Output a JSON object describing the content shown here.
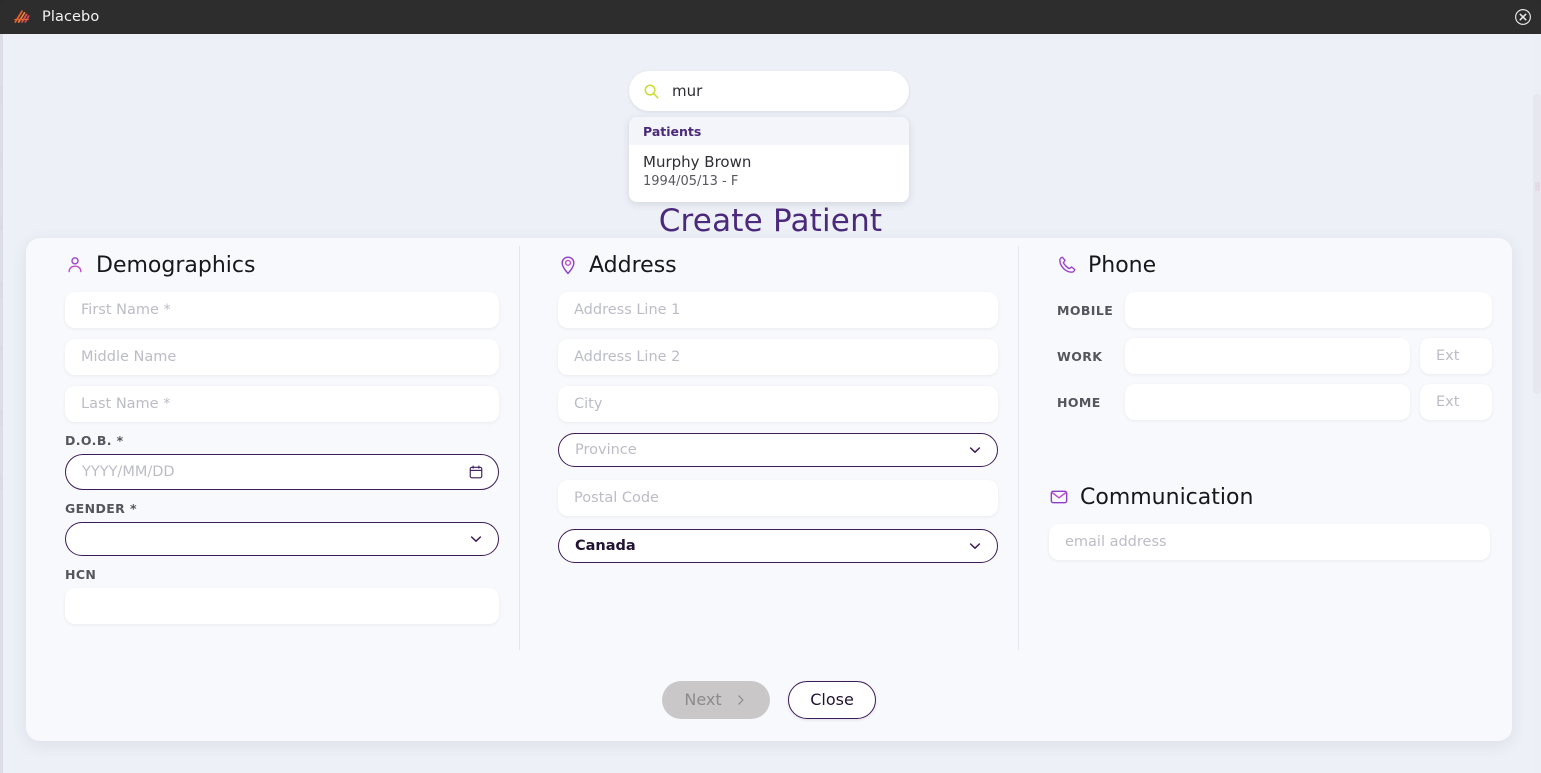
{
  "window": {
    "title": "Placebo",
    "logo_icon": "placebo-logo-icon",
    "close_icon": "close-circle-icon"
  },
  "search": {
    "icon": "search-icon",
    "value": "mur",
    "placeholder": "",
    "results_header": "Patients",
    "results": [
      {
        "name": "Murphy Brown",
        "details": "1994/05/13 - F"
      }
    ]
  },
  "modal": {
    "title": "Create Patient",
    "sections": {
      "demographics": {
        "icon": "person-icon",
        "title": "Demographics",
        "first_name_placeholder": "First Name *",
        "middle_name_placeholder": "Middle Name",
        "last_name_placeholder": "Last Name *",
        "dob_label": "D.O.B. *",
        "dob_placeholder": "YYYY/MM/DD",
        "dob_icon": "calendar-icon",
        "gender_label": "GENDER *",
        "gender_value": "",
        "gender_icon": "chevron-down-icon",
        "hcn_label": "HCN",
        "hcn_value": ""
      },
      "address": {
        "icon": "map-pin-icon",
        "title": "Address",
        "line1_placeholder": "Address Line 1",
        "line2_placeholder": "Address Line 2",
        "city_placeholder": "City",
        "province_placeholder": "Province",
        "province_icon": "chevron-down-icon",
        "postal_placeholder": "Postal Code",
        "country_value": "Canada",
        "country_icon": "chevron-down-icon"
      },
      "phone": {
        "icon": "phone-icon",
        "title": "Phone",
        "rows": [
          {
            "label": "MOBILE",
            "value": "",
            "has_ext": false,
            "ext_placeholder": ""
          },
          {
            "label": "WORK",
            "value": "",
            "has_ext": true,
            "ext_placeholder": "Ext"
          },
          {
            "label": "HOME",
            "value": "",
            "has_ext": true,
            "ext_placeholder": "Ext"
          }
        ]
      },
      "communication": {
        "icon": "mail-icon",
        "title": "Communication",
        "email_placeholder": "email address"
      }
    },
    "footer": {
      "next_label": "Next",
      "next_icon": "chevron-right-icon",
      "next_disabled": true,
      "close_label": "Close"
    }
  },
  "colors": {
    "accent_purple": "#4b2a7b",
    "border_purple": "#3c1b59",
    "icon_pink": "#c24bd0",
    "search_icon_green": "#cddc39",
    "titlebar_bg": "#2d2d2d",
    "app_bg": "#eceef5",
    "card_bg": "#f8f9fc"
  }
}
